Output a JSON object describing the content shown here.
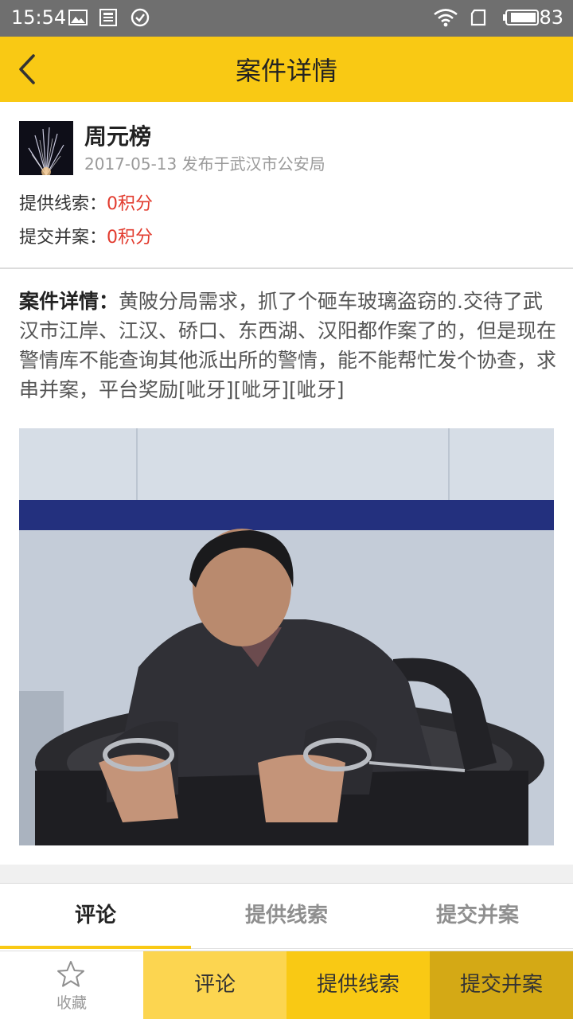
{
  "status_bar": {
    "time": "15:54",
    "battery": "83"
  },
  "header": {
    "title": "案件详情"
  },
  "case": {
    "publisher": "周元榜",
    "publish_info": "2017-05-13 发布于武汉市公安局",
    "clue_label": "提供线索：",
    "clue_value": "0积分",
    "merge_label": "提交并案：",
    "merge_value": "0积分",
    "detail_label": "案件详情：",
    "detail_text": "黄陂分局需求，抓了个砸车玻璃盗窃的.交待了武汉市江岸、江汉、硚口、东西湖、汉阳都作案了的，但是现在警情库不能查询其他派出所的警情，能不能帮忙发个协查，求串并案，平台奖励[呲牙][呲牙][呲牙]"
  },
  "tabs": [
    {
      "label": "评论",
      "active": true
    },
    {
      "label": "提供线索",
      "active": false
    },
    {
      "label": "提交并案",
      "active": false
    }
  ],
  "bottom_bar": {
    "favorite_label": "收藏",
    "favorite_icon": "star-outline-icon",
    "buttons": [
      "评论",
      "提供线索",
      "提交并案"
    ]
  },
  "colors": {
    "accent": "#f9c914",
    "status_bar": "#6f6f6f",
    "points_red": "#e23b2e"
  }
}
